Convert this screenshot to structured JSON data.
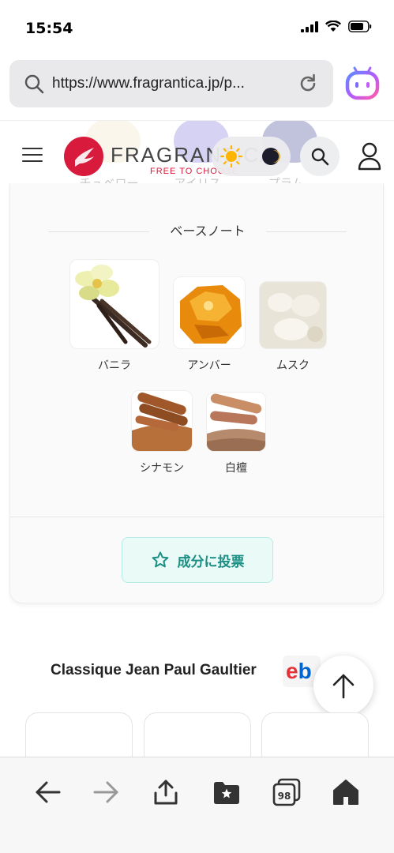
{
  "status_bar": {
    "time": "15:54"
  },
  "browser": {
    "url": "https://www.fragrantica.jp/p..."
  },
  "site_header": {
    "logo_text": "FRAGRANTICA",
    "logo_tagline": "FREE TO CHOOSE",
    "background_notes": [
      "チュベローズ",
      "アイリス",
      "プラム"
    ]
  },
  "notes_section": {
    "title": "ベースノート",
    "notes": [
      {
        "label": "バニラ",
        "icon": "vanilla"
      },
      {
        "label": "アンバー",
        "icon": "amber"
      },
      {
        "label": "ムスク",
        "icon": "musk"
      },
      {
        "label": "シナモン",
        "icon": "cinnamon"
      },
      {
        "label": "白檀",
        "icon": "sandalwood"
      }
    ],
    "vote_button_label": "成分に投票"
  },
  "related": {
    "title": "Classique Jean Paul Gaultier",
    "ebay_text": "eb"
  },
  "toolbar": {
    "tab_count": "98"
  },
  "colors": {
    "brand_red": "#d81b3c",
    "accent_teal": "#1c8f84",
    "vote_bg": "#e9faf7"
  }
}
